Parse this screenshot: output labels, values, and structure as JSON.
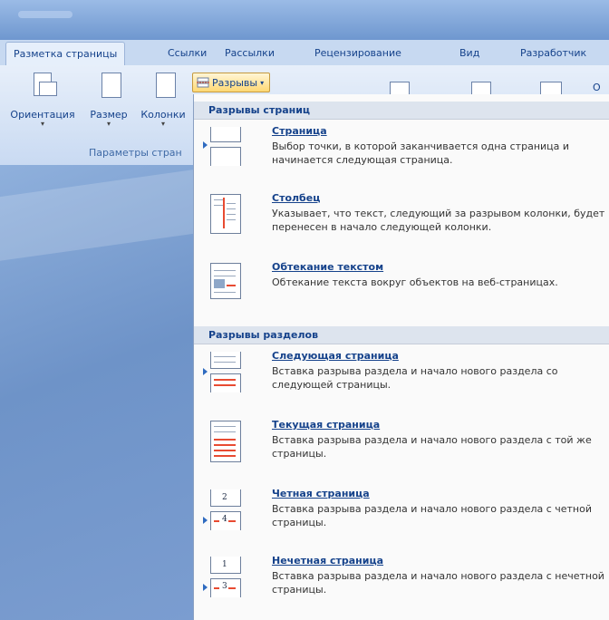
{
  "ribbon": {
    "tabs": [
      "Разметка страницы",
      "Ссылки",
      "Рассылки",
      "Рецензирование",
      "Вид",
      "Разработчик"
    ],
    "buttons": {
      "orientation": "Ориентация",
      "size": "Размер",
      "columns": "Колонки"
    },
    "group_label": "Параметры стран",
    "breaks_button": "Разрывы",
    "right_cutoff": "О"
  },
  "menu": {
    "page_breaks_header": "Разрывы страниц",
    "section_breaks_header": "Разрывы разделов",
    "items": [
      {
        "title": "Страница",
        "desc": "Выбор точки, в которой заканчивается одна страница и начинается следующая страница.",
        "icon": "page-break-icon"
      },
      {
        "title": "Столбец",
        "desc": "Указывает, что текст, следующий за разрывом колонки, будет перенесен в начало следующей колонки.",
        "icon": "column-break-icon"
      },
      {
        "title": "Обтекание текстом",
        "desc": "Обтекание текста вокруг объектов на веб-страницах.",
        "icon": "text-wrapping-icon"
      },
      {
        "title": "Следующая страница",
        "desc": "Вставка разрыва раздела и начало нового раздела со следующей страницы.",
        "icon": "next-page-icon"
      },
      {
        "title": "Текущая страница",
        "desc": "Вставка разрыва раздела и начало нового раздела с той же страницы.",
        "icon": "continuous-icon"
      },
      {
        "title": "Четная страница",
        "desc": "Вставка разрыва раздела и начало нового раздела с четной страницы.",
        "icon": "even-page-icon",
        "numbers": [
          "2",
          "4"
        ]
      },
      {
        "title": "Нечетная страница",
        "desc": "Вставка разрыва раздела и начало нового раздела с нечетной страницы.",
        "icon": "odd-page-icon",
        "numbers": [
          "1",
          "3"
        ]
      }
    ]
  }
}
